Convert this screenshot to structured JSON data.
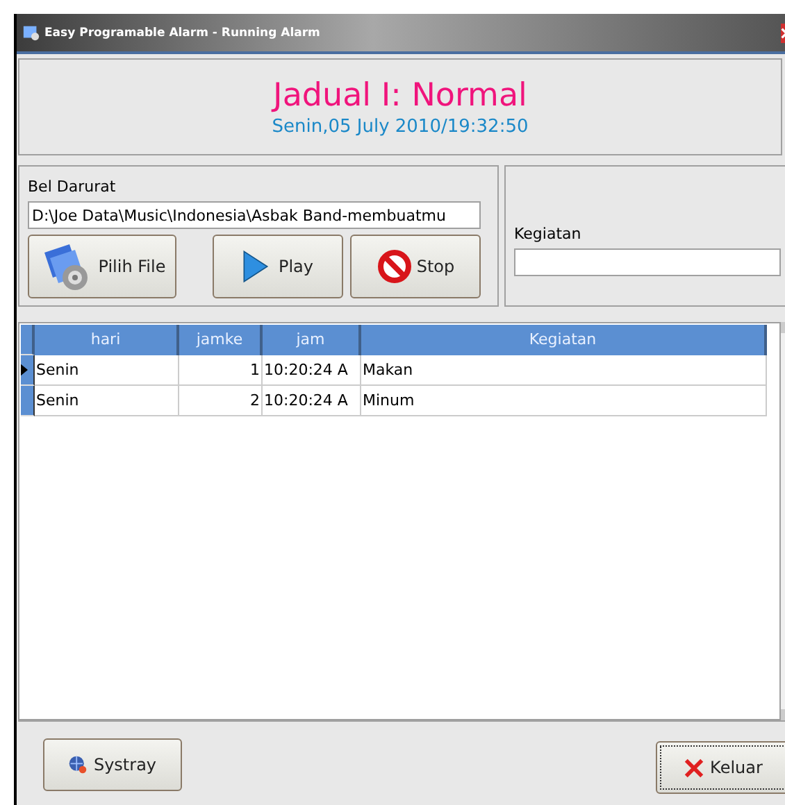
{
  "window": {
    "title": "Easy Programable Alarm - Running Alarm"
  },
  "header": {
    "title": "Jadual I: Normal",
    "datetime": "Senin,05 July 2010/19:32:50"
  },
  "emergency": {
    "label": "Bel Darurat",
    "path": "D:\\Joe Data\\Music\\Indonesia\\Asbak Band-membuatmu",
    "buttons": [
      {
        "kind": "file",
        "label": "Pilih File"
      },
      {
        "kind": "play",
        "label": "Play"
      },
      {
        "kind": "stop",
        "label": "Stop"
      }
    ]
  },
  "activity": {
    "label": "Kegiatan"
  },
  "table": {
    "columns": [
      "hari",
      "jamke",
      "jam",
      "Kegiatan"
    ],
    "rows": [
      {
        "current": true,
        "cells": [
          "Senin",
          "1",
          "10:20:24 A",
          "Makan"
        ]
      },
      {
        "current": false,
        "cells": [
          "Senin",
          "2",
          "10:20:24 A",
          "Minum"
        ]
      }
    ]
  },
  "footer": {
    "buttons": [
      {
        "kind": "systray",
        "label": "Systray",
        "focused": false
      },
      {
        "kind": "exit",
        "label": "Keluar",
        "focused": true
      }
    ]
  }
}
